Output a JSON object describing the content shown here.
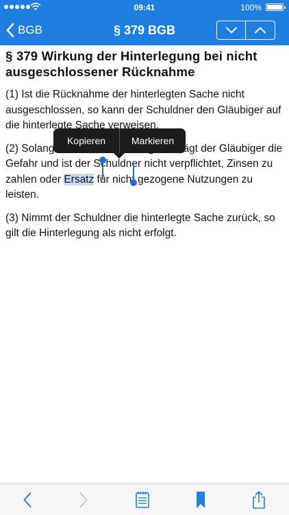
{
  "status_bar": {
    "time": "09:41",
    "battery": "100%"
  },
  "nav": {
    "back_label": "BGB",
    "title": "§ 379 BGB"
  },
  "article": {
    "heading": "§ 379 Wirkung der Hinterlegung bei nicht ausgeschlossener Rücknahme",
    "p1": "(1) Ist die Rücknahme der hinterlegten Sache nicht ausgeschlossen, so kann der Schuldner den Gläubiger auf die hinterlegte Sache verweisen.",
    "p2_before": "(2) Solange die Sache hinterlegt ist, trägt der Gläubiger die Gefahr und ist der Schuldner nicht verpflichtet, Zinsen zu zahlen oder ",
    "p2_selected": "Ersatz",
    "p2_after": " für nicht gezogene Nutzungen zu leisten.",
    "p3": "(3) Nimmt der Schuldner die hinterlegte Sache zurück, so gilt die Hinterlegung als nicht erfolgt."
  },
  "edit_menu": {
    "copy": "Kopieren",
    "mark": "Markieren"
  },
  "colors": {
    "accent": "#1f7fe0",
    "selection": "#c6dbf4",
    "toolbar_icon": "#1f7fe0",
    "toolbar_icon_disabled": "#c7c7cc"
  },
  "icons": {
    "back": "chevron-left-icon",
    "next_article": "chevron-down-icon",
    "prev_article": "chevron-up-icon",
    "toolbar_back": "chevron-left-icon",
    "toolbar_forward": "chevron-right-icon",
    "notes": "notepad-icon",
    "bookmark": "bookmark-icon",
    "share": "share-icon"
  }
}
